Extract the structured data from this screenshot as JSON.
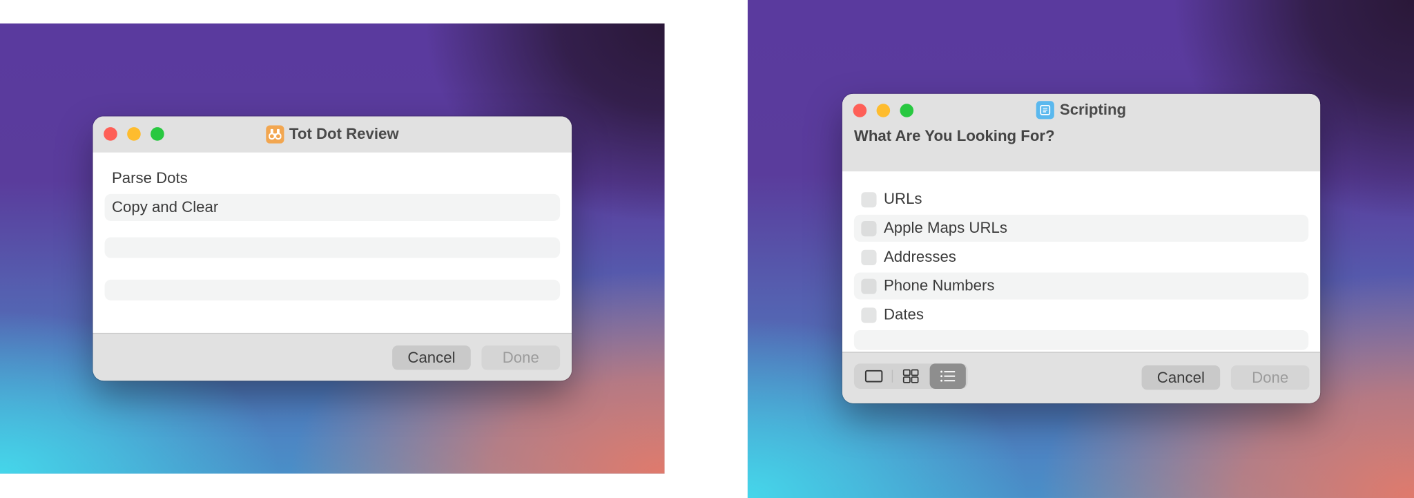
{
  "left_window": {
    "title": "Tot Dot Review",
    "app_icon": "binoculars-icon",
    "app_icon_color": "#f2a650",
    "rows": [
      {
        "label": "Parse Dots"
      },
      {
        "label": "Copy and Clear"
      },
      {
        "label": ""
      },
      {
        "label": ""
      },
      {
        "label": ""
      },
      {
        "label": ""
      }
    ],
    "buttons": {
      "cancel": "Cancel",
      "done": "Done"
    }
  },
  "right_window": {
    "title": "Scripting",
    "app_icon": "script-document-icon",
    "app_icon_color": "#5ab8ee",
    "prompt": "What Are You Looking For?",
    "options": [
      {
        "label": "URLs",
        "checked": false
      },
      {
        "label": "Apple Maps URLs",
        "checked": false
      },
      {
        "label": "Addresses",
        "checked": false
      },
      {
        "label": "Phone Numbers",
        "checked": false
      },
      {
        "label": "Dates",
        "checked": false
      }
    ],
    "view_modes": [
      {
        "name": "single-view",
        "active": false
      },
      {
        "name": "grid-view",
        "active": false
      },
      {
        "name": "list-view",
        "active": true
      }
    ],
    "buttons": {
      "cancel": "Cancel",
      "done": "Done"
    }
  },
  "colors": {
    "close": "#fe5f57",
    "minimize": "#febc2e",
    "maximize": "#28c840"
  }
}
